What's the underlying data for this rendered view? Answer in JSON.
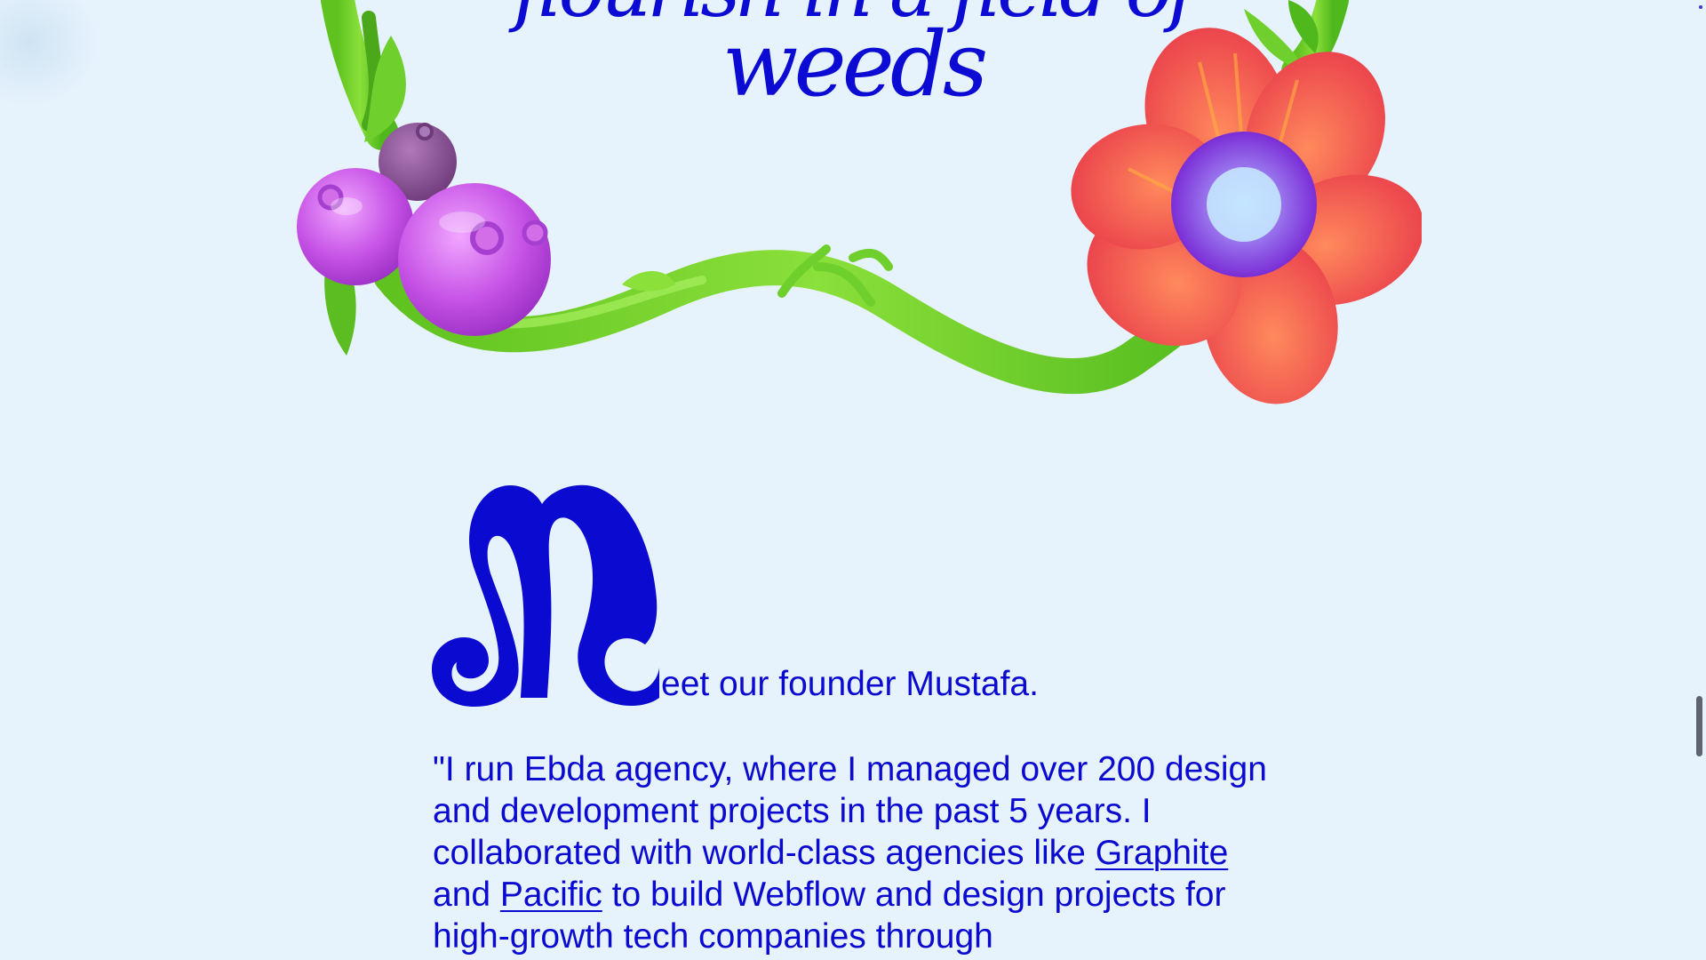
{
  "hero": {
    "headline_line1": "flourish in a field of",
    "headline_line2": "weeds"
  },
  "founder": {
    "dropcap_letter": "M",
    "intro_rest": "eet our founder Mustafa.",
    "quote_part1": "\"I run Ebda agency, where I managed over 200 design and development projects in the past 5 years. I collaborated with world-class agencies like ",
    "link_graphite": "Graphite",
    "quote_and": " and ",
    "link_pacific": "Pacific",
    "quote_part2": " to build Webflow and design projects for high-growth tech companies through"
  },
  "colors": {
    "background": "#e6f2fc",
    "text_blue": "#0a0ad0",
    "leaf_green": "#6fcf2c",
    "berry_purple": "#c45ae0",
    "flower_red": "#f0544a"
  },
  "icons": [
    "dropcap-m-icon",
    "wreath-illustration"
  ]
}
